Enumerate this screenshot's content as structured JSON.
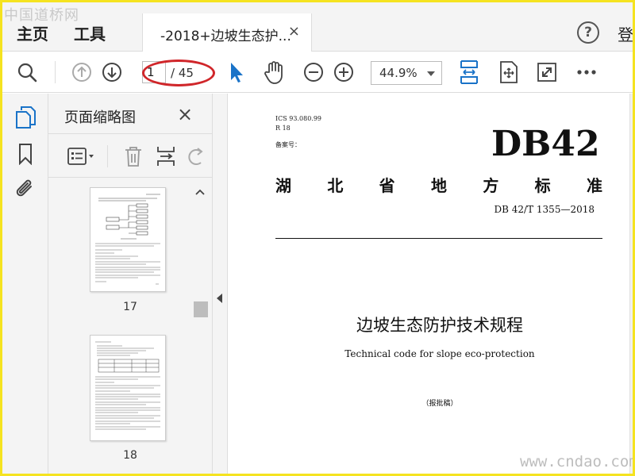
{
  "watermark_top": "中国道桥网",
  "watermark_bottom": "www.cndao.com",
  "menu": {
    "home": "主页",
    "tools": "工具"
  },
  "tab": {
    "title": "-2018+边坡生态护...",
    "close": "×"
  },
  "header_right": {
    "help": "?",
    "login": "登"
  },
  "toolbar": {
    "page_current": "1",
    "page_total": "/ 45",
    "zoom": "44.9%"
  },
  "colors": {
    "accent": "#1a73c8",
    "highlight": "#d0262a",
    "frame": "#f5e320"
  },
  "thumbnails": {
    "title": "页面缩略图",
    "close": "×",
    "pages": [
      {
        "number": "17"
      },
      {
        "number": "18"
      }
    ]
  },
  "document": {
    "ics": "ICS 93.080.99",
    "r18": "R 18",
    "beian": "备案号：",
    "code": "DB42",
    "province_chars": [
      "湖",
      "北",
      "省",
      "地",
      "方",
      "标",
      "准"
    ],
    "std_no": "DB 42/T 1355—2018",
    "title_cn": "边坡生态防护技术规程",
    "title_en": "Technical code for slope eco-protection",
    "draft": "（报批稿）"
  }
}
